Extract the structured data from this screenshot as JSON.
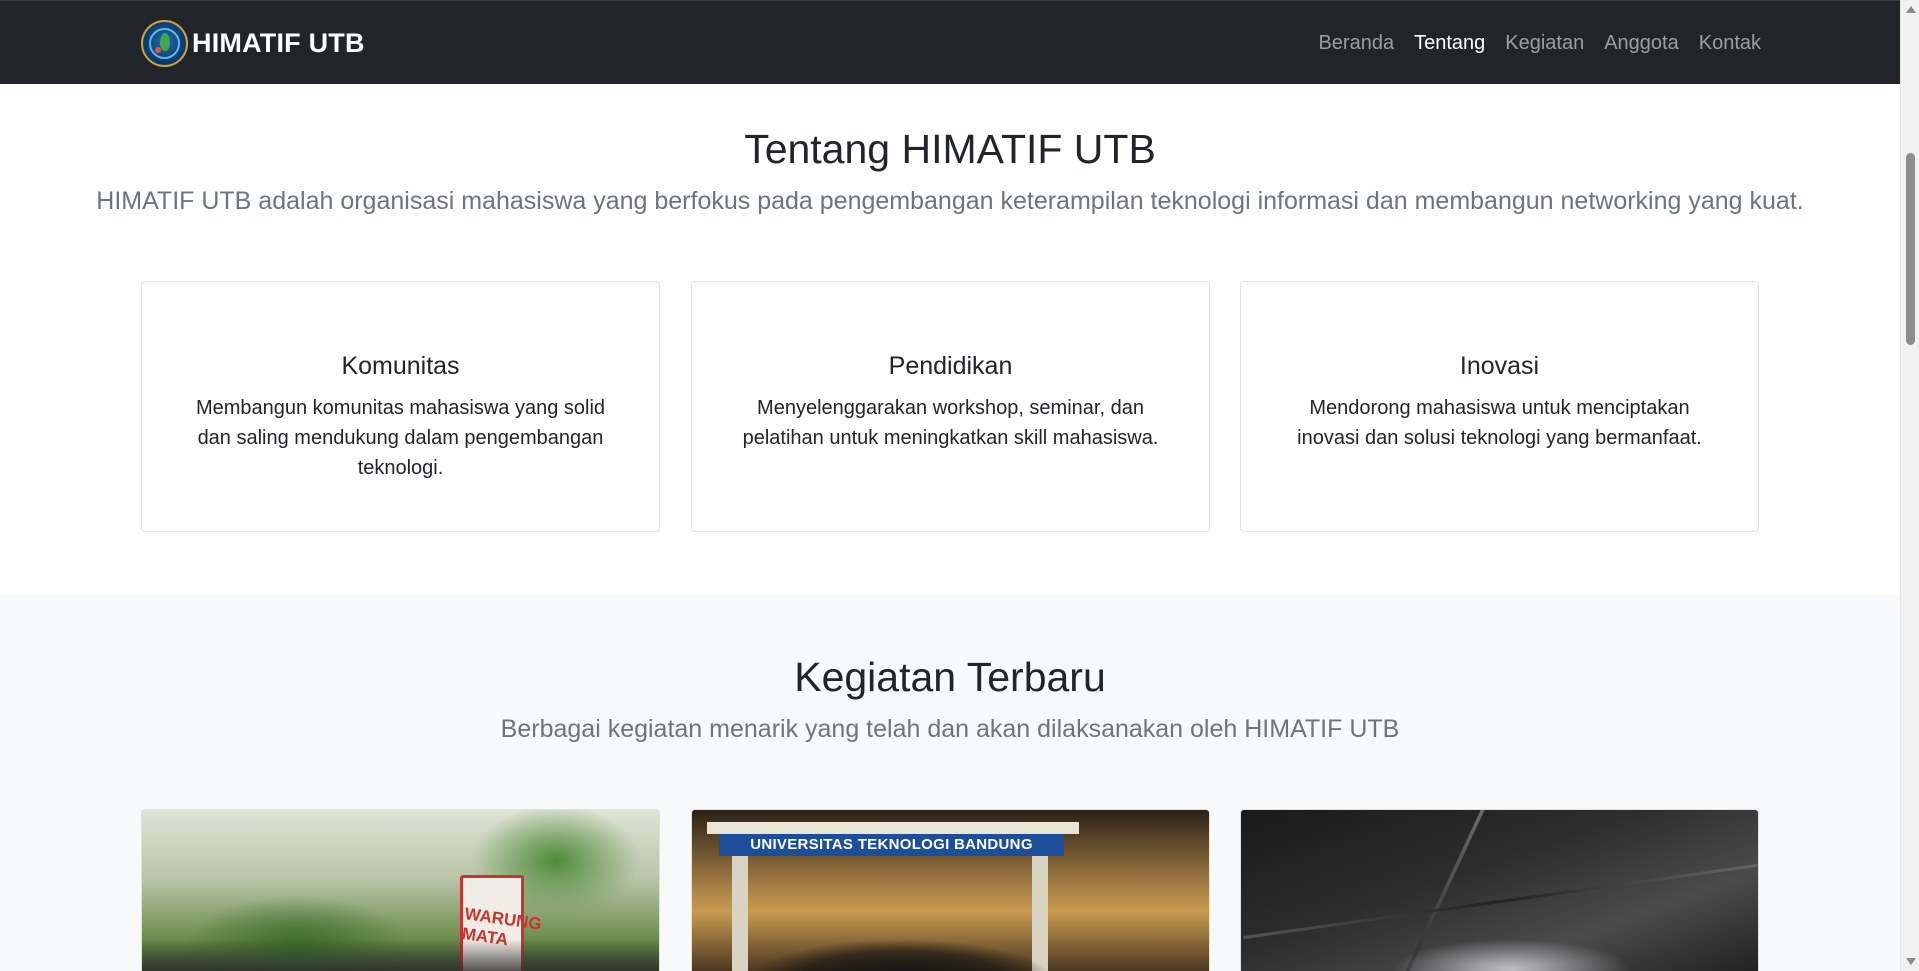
{
  "navbar": {
    "brand": "HIMATIF UTB",
    "links": [
      {
        "label": "Beranda",
        "active": false
      },
      {
        "label": "Tentang",
        "active": true
      },
      {
        "label": "Kegiatan",
        "active": false
      },
      {
        "label": "Anggota",
        "active": false
      },
      {
        "label": "Kontak",
        "active": false
      }
    ]
  },
  "about": {
    "title": "Tentang HIMATIF UTB",
    "lead": "HIMATIF UTB adalah organisasi mahasiswa yang berfokus pada pengembangan keterampilan teknologi informasi dan membangun networking yang kuat.",
    "cards": [
      {
        "title": "Komunitas",
        "text": "Membangun komunitas mahasiswa yang solid dan saling mendukung dalam pengembangan teknologi."
      },
      {
        "title": "Pendidikan",
        "text": "Menyelenggarakan workshop, seminar, dan pelatihan untuk meningkatkan skill mahasiswa."
      },
      {
        "title": "Inovasi",
        "text": "Mendorong mahasiswa untuk menciptakan inovasi dan solusi teknologi yang bermanfaat."
      }
    ]
  },
  "activities": {
    "title": "Kegiatan Terbaru",
    "lead": "Berbagai kegiatan menarik yang telah dan akan dilaksanakan oleh HIMATIF UTB",
    "photo_texts": {
      "sign": "WARUNG MATA",
      "banner": "UNIVERSITAS TEKNOLOGI BANDUNG"
    }
  },
  "colors": {
    "navbar_bg": "#212529",
    "nav_link": "#8c8f92",
    "nav_link_active": "#ffffff",
    "section_alt_bg": "#f8f9fa",
    "muted_text": "#6c757d",
    "card_border": "#dee2e6"
  }
}
